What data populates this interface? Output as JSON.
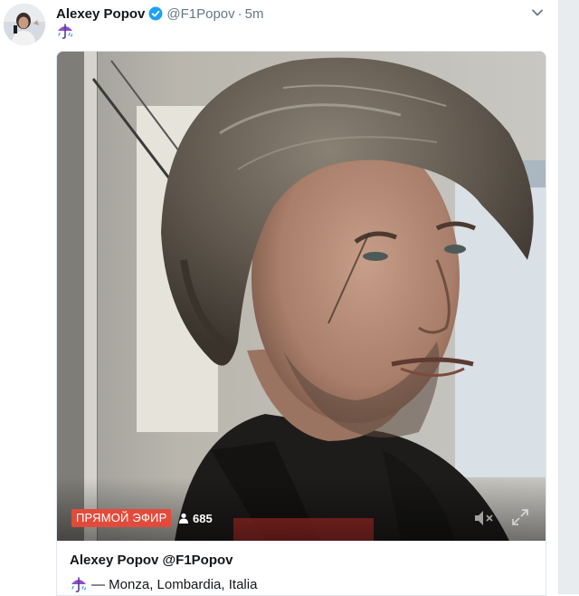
{
  "tweet": {
    "author_name": "Alexey Popov",
    "handle": "@F1Popov",
    "separator": "·",
    "time": "5m",
    "body_emoji": "umbrella-with-rain-icon"
  },
  "card": {
    "live_label": "ПРЯМОЙ ЭФИР",
    "viewer_count": "685",
    "title": "Alexey Popov @F1Popov",
    "location": "— Monza, Lombardia, Italia",
    "location_emoji": "umbrella-with-rain-icon"
  },
  "colors": {
    "live_badge": "#e24b3b",
    "verified": "#1da1f2",
    "secondary_text": "#657786",
    "umbrella": "#8a4fd0"
  }
}
